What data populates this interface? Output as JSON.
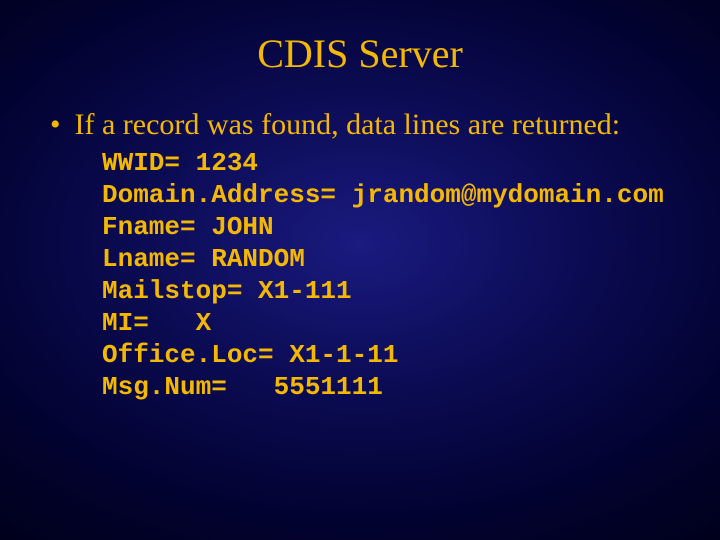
{
  "title": "CDIS Server",
  "bullet": "If a record was found, data lines are returned:",
  "code": {
    "l1": "WWID= 1234",
    "l2": "Domain.Address= jrandom@mydomain.com",
    "l3": "Fname= JOHN",
    "l4": "Lname= RANDOM",
    "l5": "Mailstop= X1-111",
    "l6": "MI=   X",
    "l7": "Office.Loc= X1-1-11",
    "l8": "Msg.Num=   5551111"
  }
}
